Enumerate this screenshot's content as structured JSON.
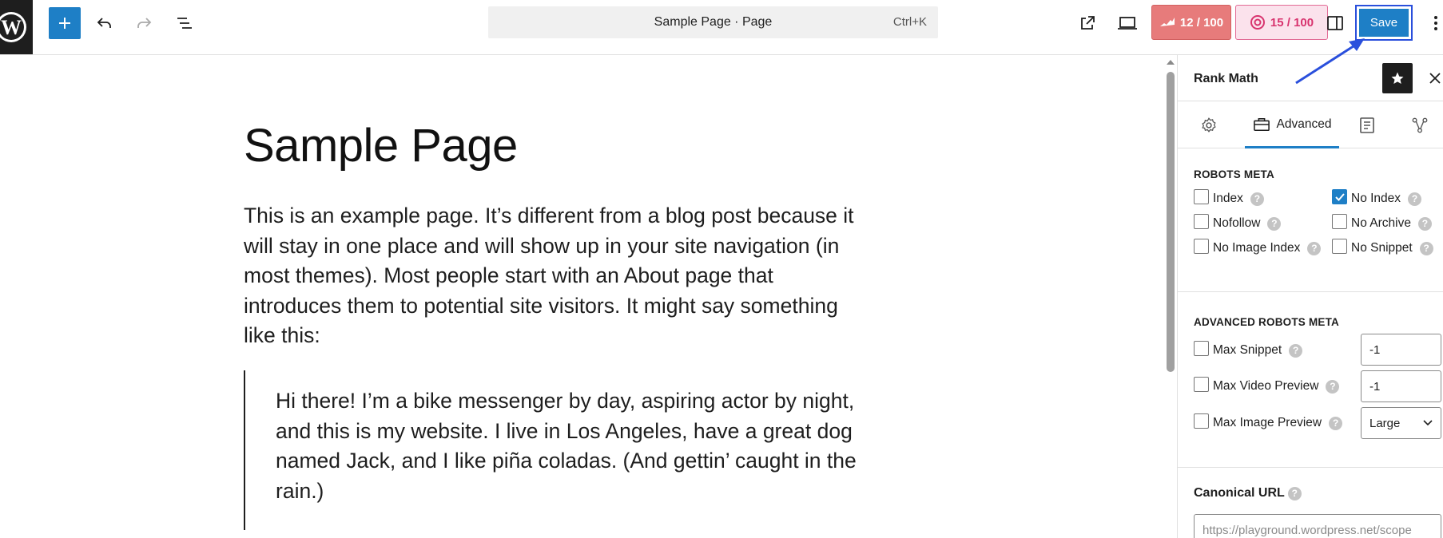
{
  "header": {
    "command_title": "Sample Page · Page",
    "command_shortcut": "Ctrl+K",
    "seo_score": "12 / 100",
    "content_score": "15 / 100",
    "save_label": "Save"
  },
  "content": {
    "title": "Sample Page",
    "paragraph": "This is an example page. It’s different from a blog post because it will stay in one place and will show up in your site navigation (in most themes). Most people start with an About page that introduces them to potential site visitors. It might say something like this:",
    "quote": "Hi there! I’m a bike messenger by day, aspiring actor by night, and this is my website. I live in Los Angeles, have a great dog named Jack, and I like piña coladas. (And gettin’ caught in the rain.)"
  },
  "sidebar": {
    "title": "Rank Math",
    "active_tab_label": "Advanced",
    "robots_meta": {
      "heading": "ROBOTS META",
      "options": [
        {
          "label": "Index",
          "checked": false
        },
        {
          "label": "No Index",
          "checked": true
        },
        {
          "label": "Nofollow",
          "checked": false
        },
        {
          "label": "No Archive",
          "checked": false
        },
        {
          "label": "No Image Index",
          "checked": false
        },
        {
          "label": "No Snippet",
          "checked": false
        }
      ]
    },
    "advanced_robots": {
      "heading": "ADVANCED ROBOTS META",
      "rows": [
        {
          "label": "Max Snippet",
          "value": "-1"
        },
        {
          "label": "Max Video Preview",
          "value": "-1"
        },
        {
          "label": "Max Image Preview",
          "value": "Large"
        }
      ]
    },
    "canonical": {
      "label": "Canonical URL",
      "placeholder": "https://playground.wordpress.net/scope"
    }
  },
  "colors": {
    "accent": "#1e7fc6",
    "seo_badge": "#e77b7b",
    "content_badge": "#fbe2ec",
    "annotation": "#2a4fdc"
  }
}
